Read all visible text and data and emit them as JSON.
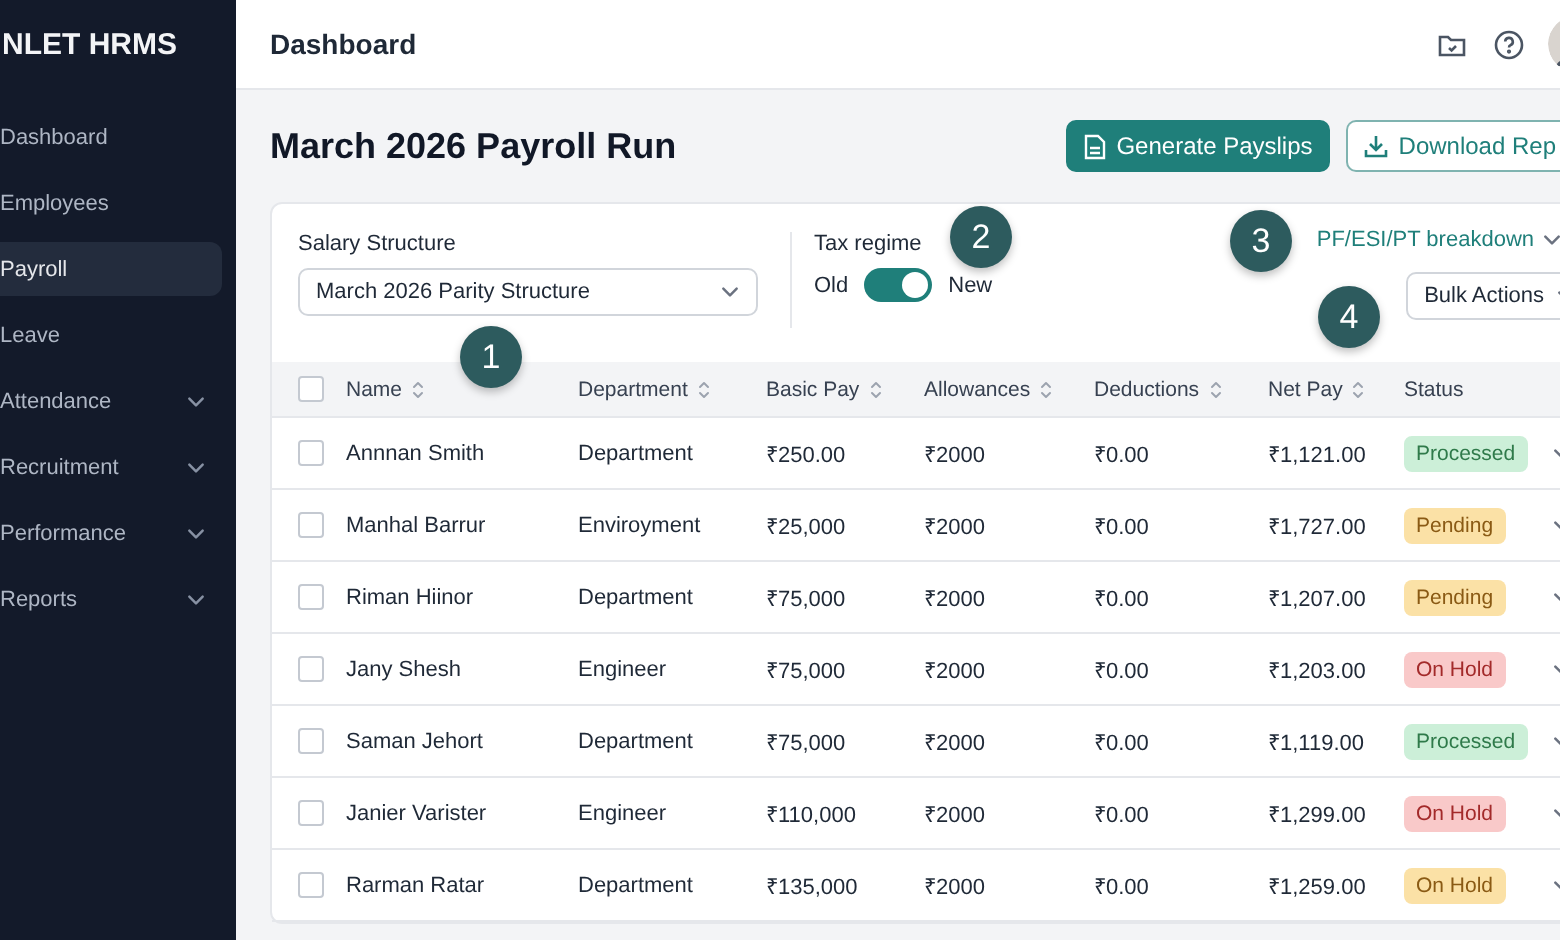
{
  "sidebar": {
    "brand": "NLET HRMS",
    "items": [
      {
        "label": "Dashboard",
        "selected": false,
        "expandable": false
      },
      {
        "label": "Employees",
        "selected": false,
        "expandable": false
      },
      {
        "label": "Payroll",
        "selected": true,
        "expandable": false
      },
      {
        "label": "Leave",
        "selected": false,
        "expandable": false
      },
      {
        "label": "Attendance",
        "selected": false,
        "expandable": true
      },
      {
        "label": "Recruitment",
        "selected": false,
        "expandable": true
      },
      {
        "label": "Performance",
        "selected": false,
        "expandable": true
      },
      {
        "label": "Reports",
        "selected": false,
        "expandable": true
      }
    ]
  },
  "header": {
    "title": "Dashboard"
  },
  "page_title": "March 2026 Payroll Run",
  "actions": [
    {
      "label": "Generate Payslips",
      "kind": "primary"
    },
    {
      "label": "Download Rep",
      "kind": "outline"
    }
  ],
  "filters": {
    "salary_structure": {
      "label": "Salary Structure",
      "value": "March 2026 Parity Structure"
    },
    "tax_regime": {
      "label": "Tax regime",
      "off_label": "Old",
      "on_label": "New",
      "on": true
    },
    "breakdown_link": "PF/ESI/PT breakdown",
    "bulk_actions": "Bulk Actions"
  },
  "callouts": [
    "1",
    "2",
    "3",
    "4"
  ],
  "table": {
    "header_checked": false,
    "columns": [
      "Name",
      "Department",
      "Basic Pay",
      "Allowances",
      "Deductions",
      "Net Pay",
      "Status"
    ],
    "rows": [
      {
        "checked": false,
        "cells": [
          "Annnan Smith",
          "Department",
          "₹250.00",
          "₹2000",
          "₹0.00",
          "₹1,121.00"
        ],
        "status": {
          "label": "Processed",
          "kind": "success"
        }
      },
      {
        "checked": false,
        "cells": [
          "Manhal Barrur",
          "Enviroyment",
          "₹25,000",
          "₹2000",
          "₹0.00",
          "₹1,727.00"
        ],
        "status": {
          "label": "Pending",
          "kind": "warning"
        }
      },
      {
        "checked": false,
        "cells": [
          "Riman Hiinor",
          "Department",
          "₹75,000",
          "₹2000",
          "₹0.00",
          "₹1,207.00"
        ],
        "status": {
          "label": "Pending",
          "kind": "warning"
        }
      },
      {
        "checked": false,
        "cells": [
          "Jany Shesh",
          "Engineer",
          "₹75,000",
          "₹2000",
          "₹0.00",
          "₹1,203.00"
        ],
        "status": {
          "label": "On Hold",
          "kind": "danger"
        }
      },
      {
        "checked": false,
        "cells": [
          "Saman Jehort",
          "Department",
          "₹75,000",
          "₹2000",
          "₹0.00",
          "₹1,119.00"
        ],
        "status": {
          "label": "Processed",
          "kind": "success"
        }
      },
      {
        "checked": false,
        "cells": [
          "Janier Varister",
          "Engineer",
          "₹110,000",
          "₹2000",
          "₹0.00",
          "₹1,299.00"
        ],
        "status": {
          "label": "On Hold",
          "kind": "danger"
        }
      },
      {
        "checked": false,
        "cells": [
          "Rarman Ratar",
          "Department",
          "₹135,000",
          "₹2000",
          "₹0.00",
          "₹1,259.00"
        ],
        "status": {
          "label": "On Hold",
          "kind": "warning"
        }
      }
    ]
  }
}
